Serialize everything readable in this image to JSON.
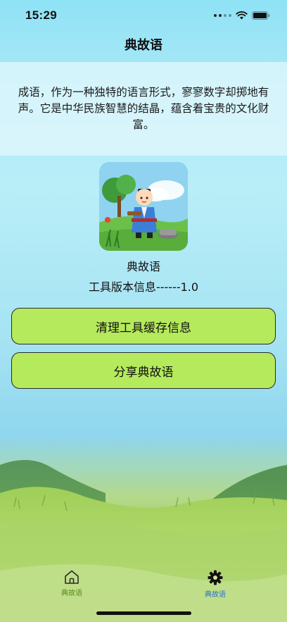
{
  "status_bar": {
    "time": "15:29"
  },
  "nav": {
    "title": "典故语"
  },
  "intro": {
    "text": "成语，作为一种独特的语言形式，寥寥数字却掷地有声。它是中华民族智慧的结晶，蕴含着宝贵的文化财富。"
  },
  "app": {
    "name": "典故语",
    "version_text": "工具版本信息------1.0"
  },
  "actions": {
    "clear_cache_label": "清理工具缓存信息",
    "share_label": "分享典故语"
  },
  "tabs": [
    {
      "label": "典故语",
      "icon": "home-icon"
    },
    {
      "label": "典故语",
      "icon": "gear-icon"
    }
  ],
  "colors": {
    "button_fill": "#b5ea5c",
    "tab_home_label": "#5a8a1a",
    "tab_settings_label": "#2f6fd0"
  }
}
